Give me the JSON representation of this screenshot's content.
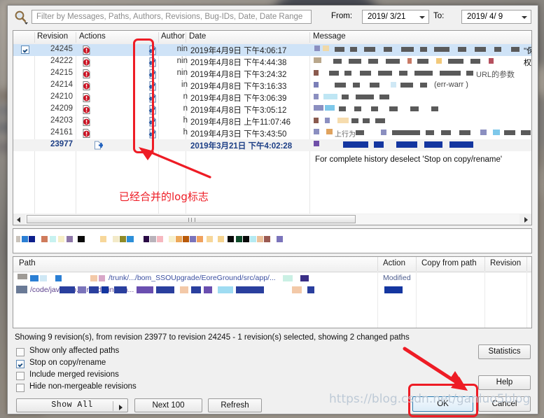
{
  "filter": {
    "placeholder": "Filter by Messages, Paths, Authors, Revisions, Bug-IDs, Date, Date Range",
    "value": "",
    "search_icon": "magnifier-icon",
    "from_label": "From:",
    "from_value": "2019/ 3/21",
    "to_label": "To:",
    "to_value": "2019/ 4/ 9"
  },
  "log_list": {
    "columns": [
      "Revision",
      "Actions",
      "Author",
      "Date",
      "Message"
    ],
    "rows": [
      {
        "checked": true,
        "revision": "24245",
        "author": "nin",
        "date": "2019年4月9日 下午4:06:17",
        "actions": [
          "modified-icon",
          "merged-icon"
        ],
        "selected": true
      },
      {
        "checked": false,
        "revision": "24222",
        "author": "nin",
        "date": "2019年4月8日 下午4:44:38",
        "actions": [
          "modified-icon",
          "merged-icon"
        ],
        "selected": false
      },
      {
        "checked": false,
        "revision": "24215",
        "author": "nin",
        "date": "2019年4月8日 下午3:24:32",
        "actions": [
          "modified-icon",
          "merged-icon"
        ],
        "selected": false
      },
      {
        "checked": false,
        "revision": "24214",
        "author": "in",
        "date": "2019年4月8日 下午3:16:33",
        "actions": [
          "modified-icon",
          "merged-icon"
        ],
        "selected": false
      },
      {
        "checked": false,
        "revision": "24210",
        "author": "n",
        "date": "2019年4月8日 下午3:06:39",
        "actions": [
          "modified-icon",
          "merged-icon"
        ],
        "selected": false
      },
      {
        "checked": false,
        "revision": "24209",
        "author": "n",
        "date": "2019年4月8日 下午3:05:12",
        "actions": [
          "modified-icon",
          "merged-icon"
        ],
        "selected": false
      },
      {
        "checked": false,
        "revision": "24203",
        "author": "h",
        "date": "2019年4月8日 上午11:07:46",
        "actions": [
          "modified-icon",
          "merged-icon"
        ],
        "selected": false
      },
      {
        "checked": false,
        "revision": "24161",
        "author": "h",
        "date": "2019年4月3日 下午3:43:50",
        "actions": [
          "modified-icon",
          "merged-icon"
        ],
        "selected": false
      },
      {
        "checked": false,
        "revision": "23977",
        "author": "",
        "date": "2019年3月21日 下午4:02:28",
        "actions": [
          "added-icon"
        ],
        "selected": false,
        "bold": true
      }
    ],
    "hint": "For complete history deselect 'Stop on copy/rename'"
  },
  "path_table": {
    "columns": [
      "Path",
      "Action",
      "Copy from path",
      "Revision"
    ],
    "rows": [
      {
        "path": "/trunk/.../bom_SSOUpgrade/EoreGround/src/app/...",
        "action": "Modified",
        "copy_from_path": "",
        "revision": ""
      },
      {
        "path": "/code/java/bro...gr/orderinfo/in...",
        "action": "",
        "copy_from_path": "",
        "revision": ""
      }
    ]
  },
  "status": {
    "text": "Showing 9 revision(s), from revision 23977 to revision 24245 - 1 revision(s) selected, showing 2 changed paths"
  },
  "checkboxes": [
    {
      "label": "Show only affected paths",
      "checked": false,
      "accel": "f"
    },
    {
      "label": "Stop on copy/rename",
      "checked": true,
      "accel": "S"
    },
    {
      "label": "Include merged revisions",
      "checked": false,
      "accel": "m"
    },
    {
      "label": "Hide non-mergeable revisions",
      "checked": false,
      "accel": "H"
    }
  ],
  "buttons": {
    "show_all": "Show  All",
    "next_100": "Next 100",
    "refresh": "Refresh",
    "statistics": "Statistics",
    "help": "Help",
    "ok": "OK",
    "cancel": "Cancel"
  },
  "annotations": {
    "merged_log_note": "已经合并的log标志",
    "accent_red": "#ee1c25",
    "watermark": "https://blog.csdn.net/ganluo5blog"
  }
}
